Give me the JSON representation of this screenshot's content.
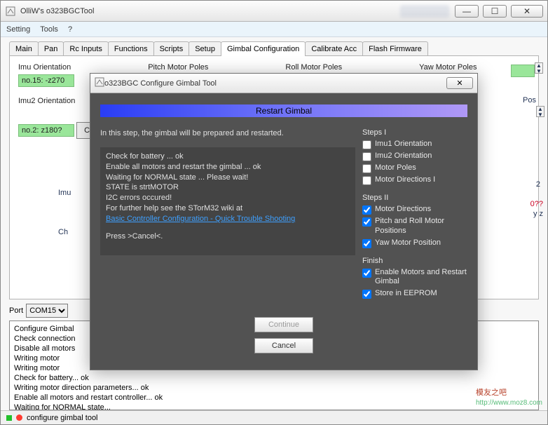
{
  "window": {
    "title": "OlliW's o323BGCTool",
    "controls": {
      "min": "—",
      "max": "☐",
      "close": "✕"
    }
  },
  "menubar": [
    "Setting",
    "Tools",
    "?"
  ],
  "tabs": [
    "Main",
    "Pan",
    "Rc Inputs",
    "Functions",
    "Scripts",
    "Setup",
    "Gimbal Configuration",
    "Calibrate Acc",
    "Flash Firmware"
  ],
  "active_tab_index": 6,
  "gimbal_page": {
    "section_labels": {
      "imu": "Imu Orientation",
      "pitch": "Pitch Motor Poles",
      "roll": "Roll Motor Poles",
      "yaw": "Yaw Motor Poles"
    },
    "imu_value": "no.15:  -z270",
    "imu2_label": "Imu2 Orientation",
    "imu2_value": "no.2:  z180?",
    "configure_btn": "Configure Gimbal",
    "right_peek": {
      "pos_label": "Pos",
      "lines": [
        "2",
        "",
        "0??",
        "y z"
      ],
      "imu_short": "Imu",
      "ch_short": "Ch"
    }
  },
  "port": {
    "label": "Port",
    "value": "COM15"
  },
  "log_lines": [
    "Configure Gimbal",
    "Check connection",
    "Disable all motors",
    "Writing motor",
    "Writing motor",
    "Check for battery... ok",
    "Writing motor direction parameters... ok",
    "Enable all motors and restart controller... ok",
    "Waiting for NORMAL state..."
  ],
  "status": {
    "text": "configure gimbal tool"
  },
  "dialog": {
    "title": "o323BGC Configure Gimbal Tool",
    "heading": "Restart Gimbal",
    "intro": "In this step, the gimbal will be prepared and restarted.",
    "body_lines": [
      "Check for battery ... ok",
      "Enable all motors and restart the gimbal ... ok",
      "Waiting for NORMAL state ... Please wait!",
      "",
      "STATE is strtMOTOR",
      "",
      "I2C errors occured!",
      "For further help see the STorM32 wiki at"
    ],
    "help_link": "Basic Controller Configuration - Quick Trouble Shooting",
    "press_cancel": "Press >Cancel<.",
    "steps1_title": "Steps I",
    "steps1": [
      {
        "label": "Imu1 Orientation",
        "checked": false
      },
      {
        "label": "Imu2 Orientation",
        "checked": false
      },
      {
        "label": "Motor Poles",
        "checked": false
      },
      {
        "label": "Motor Directions I",
        "checked": false
      }
    ],
    "steps2_title": "Steps II",
    "steps2": [
      {
        "label": "Motor Directions",
        "checked": true
      },
      {
        "label": "Pitch and Roll Motor Positions",
        "checked": true
      },
      {
        "label": "Yaw Motor Position",
        "checked": true
      }
    ],
    "finish_title": "Finish",
    "finish": [
      {
        "label": "Enable Motors and Restart Gimbal",
        "checked": true
      },
      {
        "label": "Store in EEPROM",
        "checked": true
      }
    ],
    "btn_continue": "Continue",
    "btn_cancel": "Cancel"
  },
  "watermark": {
    "brand": "模友之吧",
    "url": "http://www.moz8.com"
  }
}
